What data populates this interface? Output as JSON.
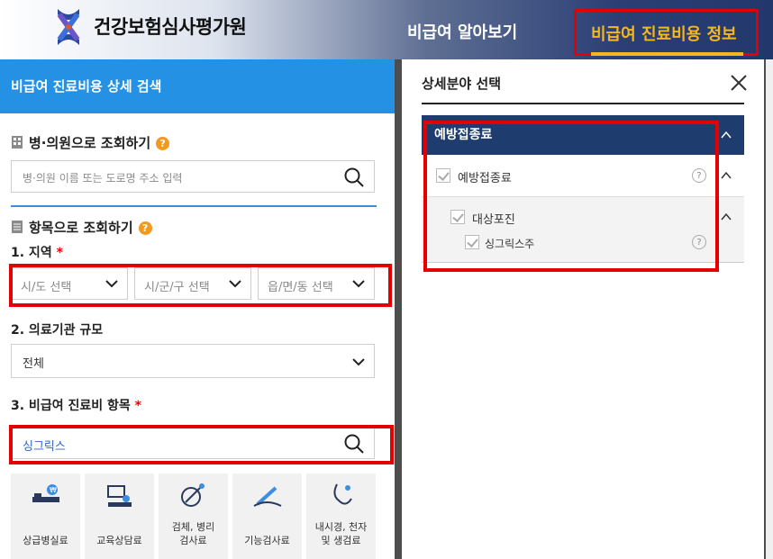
{
  "header": {
    "brand": "건강보험심사평가원",
    "nav": [
      {
        "label": "비급여 알아보기"
      },
      {
        "label": "비급여 진료비용 정보"
      }
    ]
  },
  "left_panel": {
    "title": "비급여 진료비용 상세 검색",
    "hospital_section": {
      "title": "병·의원으로 조회하기",
      "search_placeholder": "병·의원 이름 또는 도로명 주소 입력"
    },
    "item_section": {
      "title": "항목으로 조회하기",
      "region_label": "1. 지역",
      "required_mark": "*",
      "region_selects": [
        {
          "placeholder": "시/도 선택"
        },
        {
          "placeholder": "시/군/구 선택"
        },
        {
          "placeholder": "읍/면/동 선택"
        }
      ],
      "scale_label": "2. 의료기관 규모",
      "scale_value": "전체",
      "item_label": "3. 비급여 진료비 항목",
      "item_value": "싱그릭스"
    },
    "categories": [
      {
        "label": "상급병실료"
      },
      {
        "label": "교육상담료"
      },
      {
        "label": "검체, 병리\n검사료"
      },
      {
        "label": "기능검사료"
      },
      {
        "label": "내시경, 천자\n및 생검료"
      }
    ]
  },
  "right_panel": {
    "title": "상세분야 선택",
    "tree": {
      "category": "예방접종료",
      "level1": "예방접종료",
      "level2": "대상포진",
      "level3": "싱그릭스주"
    }
  },
  "colors": {
    "header_dark": "#22386d",
    "accent_yellow": "#f4b81e",
    "left_title_bg": "#2491e5",
    "tree_head_bg": "#1e3d6e",
    "highlight_red": "#e40000",
    "help_orange": "#f39a1e"
  }
}
